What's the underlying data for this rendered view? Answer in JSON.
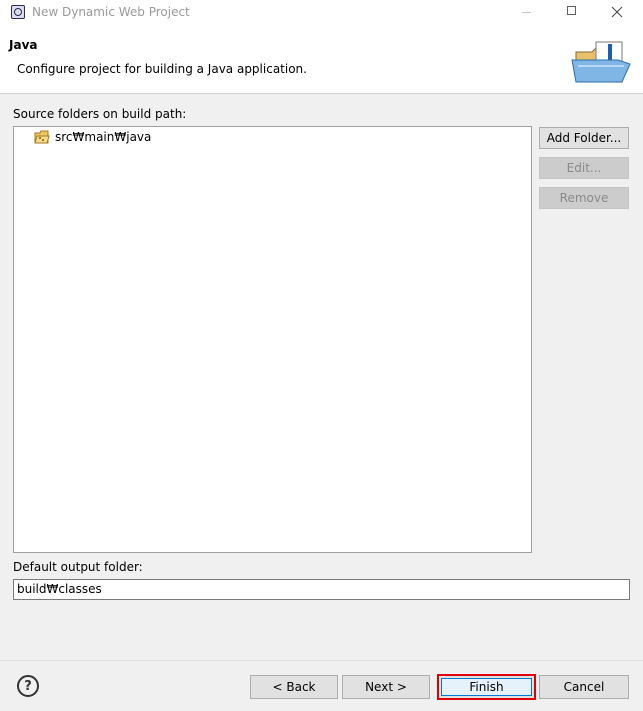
{
  "window": {
    "title": "New Dynamic Web Project"
  },
  "header": {
    "title": "Java",
    "description": "Configure project for building a Java application."
  },
  "source_folders": {
    "label": "Source folders on build path:",
    "items": [
      {
        "label": "src₩main₩java",
        "icon": "package-folder-icon"
      }
    ],
    "buttons": {
      "add": "Add Folder...",
      "edit": "Edit...",
      "remove": "Remove"
    }
  },
  "output": {
    "label": "Default output folder:",
    "value": "build₩classes"
  },
  "footer": {
    "help": "?",
    "back": "< Back",
    "next": "Next >",
    "finish": "Finish",
    "cancel": "Cancel"
  },
  "colors": {
    "highlight": "#e00000",
    "focus": "#0078d7"
  }
}
